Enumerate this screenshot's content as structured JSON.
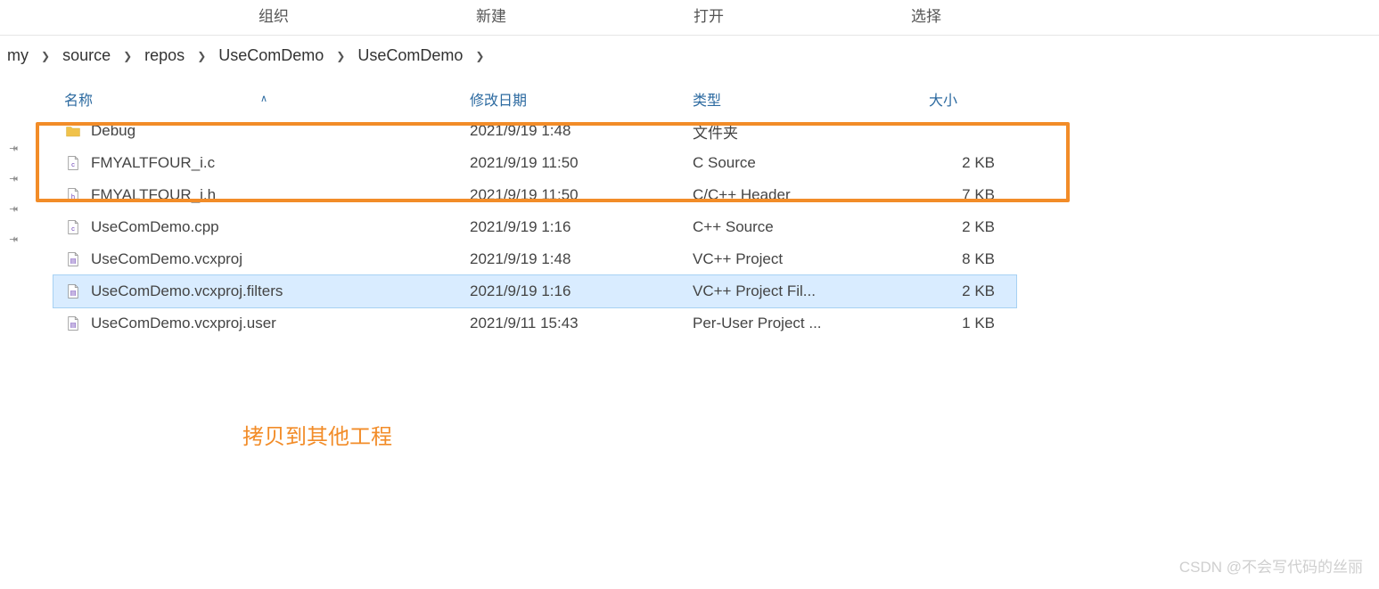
{
  "ribbon": {
    "groups": [
      "组织",
      "新建",
      "打开",
      "选择"
    ]
  },
  "breadcrumb": {
    "segments": [
      "my",
      "source",
      "repos",
      "UseComDemo",
      "UseComDemo"
    ]
  },
  "columns": {
    "name": "名称",
    "modified": "修改日期",
    "type": "类型",
    "size": "大小"
  },
  "files": [
    {
      "icon": "folder",
      "name": "Debug",
      "modified": "2021/9/19 1:48",
      "type": "文件夹",
      "size": "",
      "selected": false
    },
    {
      "icon": "c",
      "name": "FMYALTFOUR_i.c",
      "modified": "2021/9/19 11:50",
      "type": "C Source",
      "size": "2 KB",
      "selected": false
    },
    {
      "icon": "h",
      "name": "FMYALTFOUR_i.h",
      "modified": "2021/9/19 11:50",
      "type": "C/C++ Header",
      "size": "7 KB",
      "selected": false
    },
    {
      "icon": "cpp",
      "name": "UseComDemo.cpp",
      "modified": "2021/9/19 1:16",
      "type": "C++ Source",
      "size": "2 KB",
      "selected": false
    },
    {
      "icon": "vcxproj",
      "name": "UseComDemo.vcxproj",
      "modified": "2021/9/19 1:48",
      "type": "VC++ Project",
      "size": "8 KB",
      "selected": false
    },
    {
      "icon": "filters",
      "name": "UseComDemo.vcxproj.filters",
      "modified": "2021/9/19 1:16",
      "type": "VC++ Project Fil...",
      "size": "2 KB",
      "selected": true
    },
    {
      "icon": "user",
      "name": "UseComDemo.vcxproj.user",
      "modified": "2021/9/11 15:43",
      "type": "Per-User Project ...",
      "size": "1 KB",
      "selected": false
    }
  ],
  "annotation": "拷贝到其他工程",
  "watermark": "CSDN @不会写代码的丝丽"
}
